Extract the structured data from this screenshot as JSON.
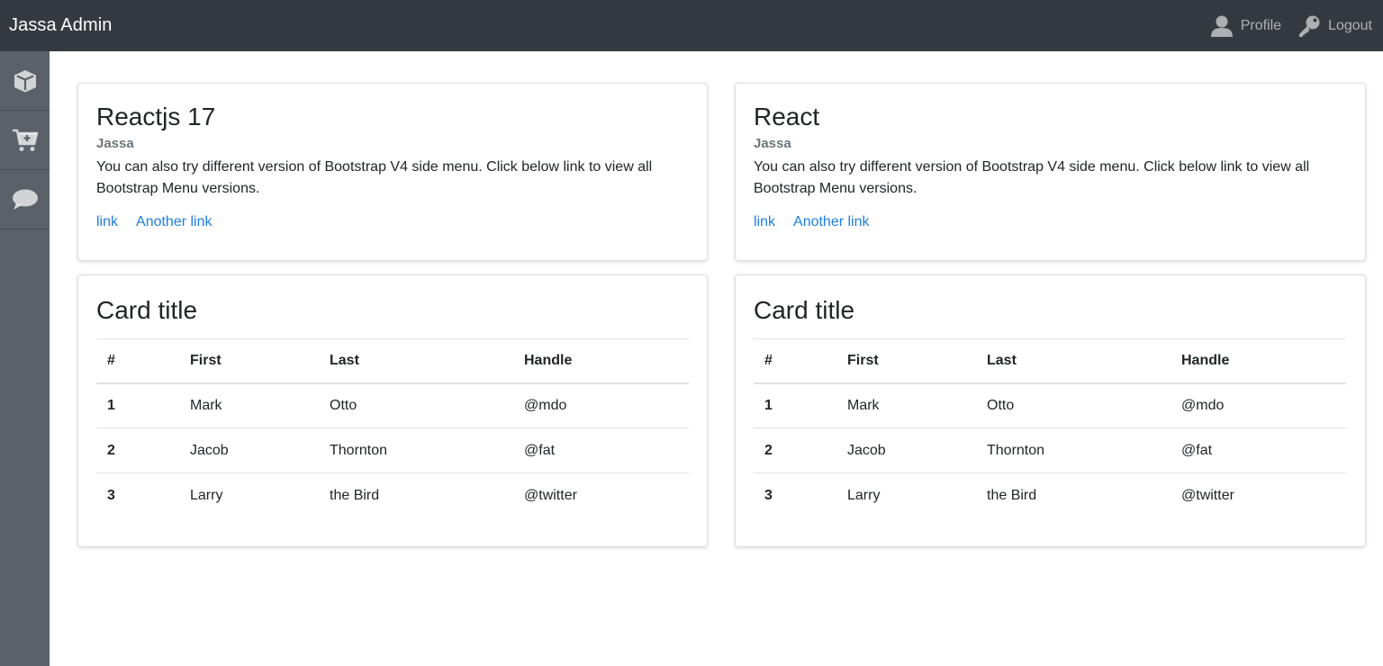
{
  "header": {
    "brand": "Jassa Admin",
    "nav": [
      {
        "label": "Profile",
        "icon": "user-icon"
      },
      {
        "label": "Logout",
        "icon": "key-icon"
      }
    ]
  },
  "sidebar": {
    "items": [
      {
        "icon": "cube-icon"
      },
      {
        "icon": "cart-plus-icon"
      },
      {
        "icon": "comment-icon"
      }
    ]
  },
  "cards": [
    {
      "title": "Reactjs 17",
      "subtitle": "Jassa",
      "text": "You can also try different version of Bootstrap V4 side menu. Click below link to view all Bootstrap Menu versions.",
      "links": [
        "link",
        "Another link"
      ]
    },
    {
      "title": "React",
      "subtitle": "Jassa",
      "text": "You can also try different version of Bootstrap V4 side menu. Click below link to view all Bootstrap Menu versions.",
      "links": [
        "link",
        "Another link"
      ]
    }
  ],
  "tables": [
    {
      "title": "Card title",
      "columns": [
        "#",
        "First",
        "Last",
        "Handle"
      ],
      "rows": [
        [
          "1",
          "Mark",
          "Otto",
          "@mdo"
        ],
        [
          "2",
          "Jacob",
          "Thornton",
          "@fat"
        ],
        [
          "3",
          "Larry",
          "the Bird",
          "@twitter"
        ]
      ]
    },
    {
      "title": "Card title",
      "columns": [
        "#",
        "First",
        "Last",
        "Handle"
      ],
      "rows": [
        [
          "1",
          "Mark",
          "Otto",
          "@mdo"
        ],
        [
          "2",
          "Jacob",
          "Thornton",
          "@fat"
        ],
        [
          "3",
          "Larry",
          "the Bird",
          "@twitter"
        ]
      ]
    }
  ],
  "colors": {
    "topbar": "#343a40",
    "sidebar": "#5a6169",
    "link": "#1e7ee0",
    "muted": "#6c757d"
  }
}
